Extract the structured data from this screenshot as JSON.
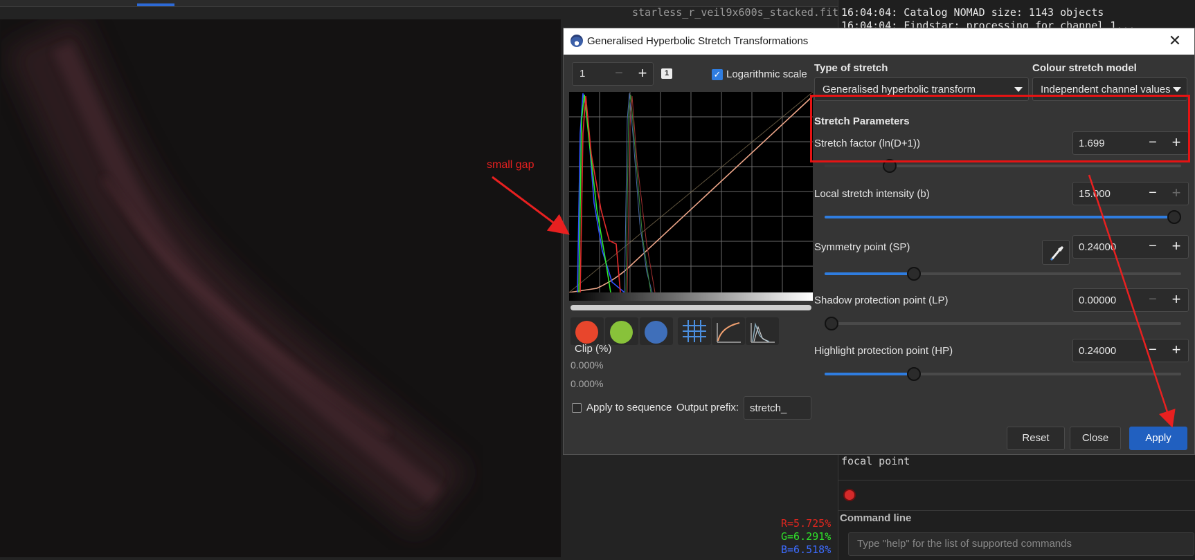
{
  "background": {
    "filename": "starless_r_veil9x600s_stacked.fit",
    "readout": {
      "r": "R=5.725%",
      "g": "G=6.291%",
      "b": "B=6.518%"
    }
  },
  "console": {
    "lines": [
      "16:04:04: Catalog NOMAD size: 1143 objects",
      "16:04:04: Findstar: processing for channel 1..."
    ],
    "focal_line": "focal point",
    "command_label": "Command line",
    "command_placeholder": "Type \"help\" for the list of supported commands"
  },
  "dialog": {
    "title": "Generalised Hyperbolic Stretch Transformations",
    "close_glyph": "✕",
    "zoom_value": "1",
    "zoom_minus": "−",
    "zoom_plus": "+",
    "zoom_badge": "1",
    "log_scale_label": "Logarithmic scale",
    "log_scale_checked": true,
    "clip_label": "Clip (%)",
    "clip_values": [
      "0.000%",
      "0.000%"
    ],
    "apply_sequence_label": "Apply to sequence",
    "output_prefix_label": "Output prefix:",
    "output_prefix_value": "stretch_",
    "type_of_stretch_label": "Type of stretch",
    "type_of_stretch_value": "Generalised hyperbolic transform",
    "colour_model_label": "Colour stretch model",
    "colour_model_value": "Independent channel values",
    "stretch_params_label": "Stretch Parameters",
    "params": [
      {
        "label": "Stretch factor (ln(D+1))",
        "value": "1.699",
        "level": 0.17
      },
      {
        "label": "Local stretch intensity (b)",
        "value": "15.000",
        "level": 1.0
      },
      {
        "label": "Symmetry point (SP)",
        "value": "0.24000",
        "level": 0.24
      },
      {
        "label": "Shadow protection point (LP)",
        "value": "0.00000",
        "level": 0.0
      },
      {
        "label": "Highlight protection point (HP)",
        "value": "0.24000",
        "level": 0.24
      }
    ],
    "buttons": {
      "reset": "Reset",
      "close": "Close",
      "apply": "Apply"
    },
    "channel_colors": {
      "red": "#e8462c",
      "green": "#88c23a",
      "blue": "#3f6fba"
    }
  },
  "annotation": {
    "text": "small gap",
    "color": "#e82020"
  }
}
